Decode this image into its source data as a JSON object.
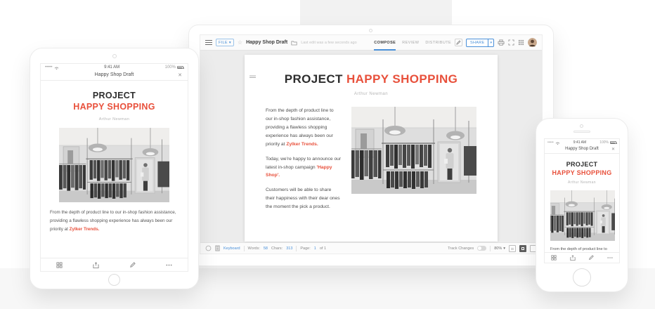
{
  "colors": {
    "accent_red": "#E8503B",
    "accent_blue": "#4A90D9"
  },
  "icons": {
    "close": "✕",
    "caret_down": "▾",
    "star": "☆",
    "carrier": "•••••"
  },
  "device_mobile": {
    "time": "9:41 AM",
    "battery_pct": "100%",
    "nav_title": "Happy Shop Draft"
  },
  "document": {
    "title_black": "PROJECT",
    "title_red": "HAPPY SHOPPING",
    "byline": "Arthur Newman",
    "p1_text": "From the depth of product line to our in-shop fashion assistance, providing a flawless shopping experience has always been our priority at",
    "p1_highlight": "Zylker Trends.",
    "p2_text": "Today, we're happy to announce our latest in-shop campaign",
    "p2_highlight": "'Happy Shop'.",
    "p3_text": "Customers will be able to share their happiness with their dear ones the moment the pick a product."
  },
  "editor": {
    "file_button": "FILE",
    "doc_title": "Happy Shop Draft",
    "last_edit": "Last edit was a few seconds ago",
    "tabs": {
      "compose": "COMPOSE",
      "review": "REVIEW",
      "distribute": "DISTRIBUTE"
    },
    "share": "SHARE",
    "status": {
      "keyboard": "Keyboard",
      "words_label": "Words:",
      "words_value": "58",
      "chars_label": "Chars:",
      "chars_value": "313",
      "page_label": "Page:",
      "page_value": "1",
      "page_of": "of 1",
      "track_changes": "Track Changes",
      "zoom": "80%"
    }
  }
}
